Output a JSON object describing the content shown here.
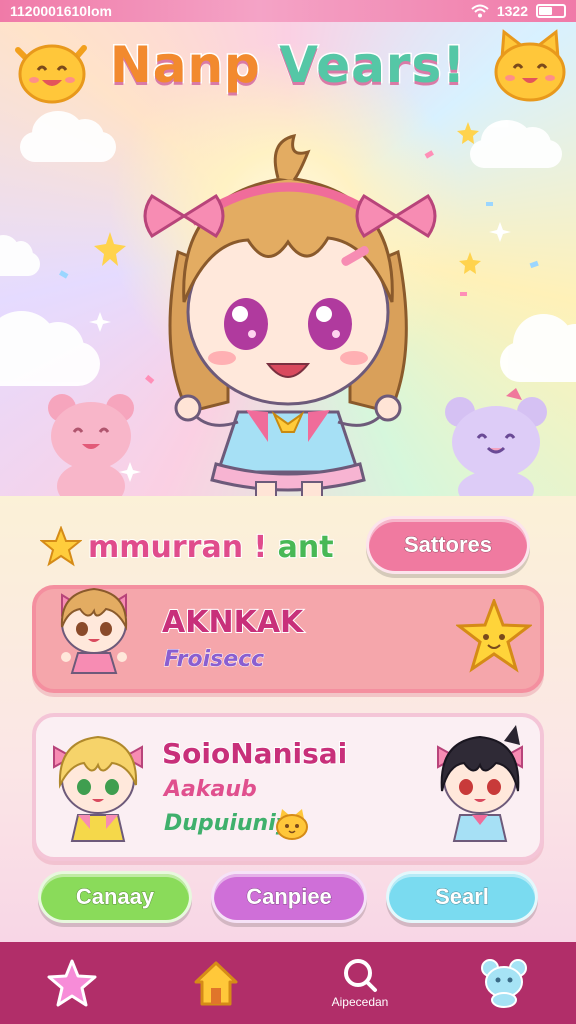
{
  "status_bar": {
    "time": "1120001610lom",
    "clock_right": "1322",
    "battery_level": 0.55
  },
  "header": {
    "title_part1": "Nanp",
    "title_part2": "Vears!"
  },
  "welcome": {
    "text_main": "mmurran !",
    "text_accent": "ant"
  },
  "buttons": {
    "top_right": "Sattores",
    "bottom_left": "Canaay",
    "bottom_middle": "Canpiee",
    "bottom_right": "Searl"
  },
  "cards": [
    {
      "name": "AKNKAK",
      "subtitle": "Froisecc"
    },
    {
      "name": "SoioNanisai",
      "line2": "Aakaub",
      "line3": "Dupuiuniy"
    }
  ],
  "nav": [
    {
      "icon": "star-icon",
      "label": ""
    },
    {
      "icon": "home-icon",
      "label": ""
    },
    {
      "icon": "search-icon",
      "label": "Aipecedan"
    },
    {
      "icon": "bear-icon",
      "label": ""
    }
  ],
  "colors": {
    "nav_bg": "#b12e69",
    "title_orange": "#f28a2e",
    "title_green": "#55c7a6",
    "accent_pink": "#e04c8c"
  }
}
